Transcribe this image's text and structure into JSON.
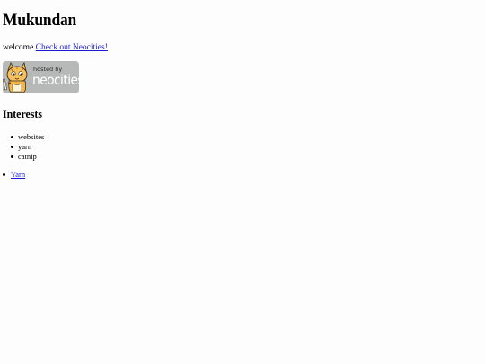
{
  "page": {
    "title": "Mukundan",
    "welcome_text": "welcome",
    "welcome_link": "Check out Neocities!"
  },
  "badge": {
    "hosted_by": "hosted by",
    "brand": "neocities",
    "icon": "neocities-cat-logo"
  },
  "interests": {
    "heading": "Interests",
    "items": [
      "websites",
      "yarn",
      "catnip"
    ]
  },
  "links": {
    "items": [
      "Yarn"
    ]
  },
  "colors": {
    "link": "#1a1ad6",
    "badge_background": "#b7b9b8",
    "page_background": "#fdfdfd"
  }
}
